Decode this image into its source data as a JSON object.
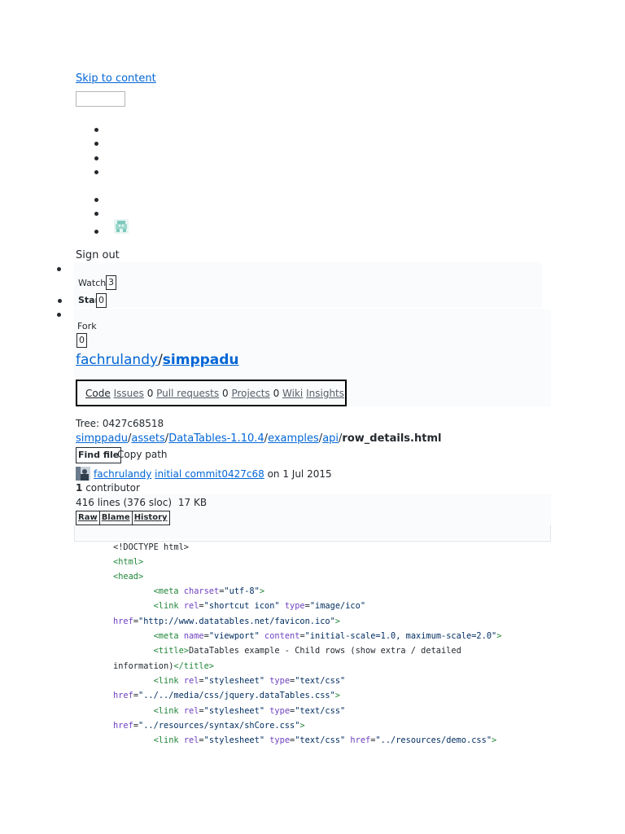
{
  "skip_link": "Skip to content",
  "search": {
    "value": "",
    "placeholder": ""
  },
  "signout": "Sign out",
  "watch": {
    "label": "Watch",
    "count": "3"
  },
  "star": {
    "label": "Star",
    "count": "0"
  },
  "fork": {
    "label": "Fork",
    "count": "0"
  },
  "repo": {
    "owner": "fachrulandy",
    "separator": "/",
    "name": "simppadu"
  },
  "tabs": {
    "code": "Code",
    "issues": "Issues",
    "issues_count": "0",
    "pulls": "Pull requests",
    "pulls_count": "0",
    "projects": "Projects",
    "projects_count": "0",
    "wiki": "Wiki",
    "insights": "Insights"
  },
  "tree": "Tree: 0427c68518",
  "breadcrumb": {
    "items": [
      "simppadu",
      "assets",
      "DataTables-1.10.4",
      "examples",
      "api"
    ],
    "sep": "/",
    "file": "row_details.html"
  },
  "find_file": "Find file",
  "copy_path": "Copy path",
  "commit": {
    "author": "fachrulandy",
    "message": "initial commit",
    "sha": "0427c68",
    "date_text": "on 1 Jul 2015"
  },
  "contributors": {
    "count": "1",
    "label": "contributor"
  },
  "file_info": {
    "lines": "416 lines (376 sloc)",
    "size": "17 KB"
  },
  "file_buttons": {
    "raw": "Raw",
    "blame": "Blame",
    "history": "History"
  },
  "code_lines": [
    [
      {
        "t": "<!DOCTYPE html>",
        "c": ""
      }
    ],
    [
      {
        "t": "<html>",
        "c": "tag"
      }
    ],
    [
      {
        "t": "<head>",
        "c": "tag"
      }
    ],
    [
      {
        "t": "        ",
        "c": ""
      },
      {
        "t": "<meta ",
        "c": "tag"
      },
      {
        "t": "charset",
        "c": "attr"
      },
      {
        "t": "=",
        "c": ""
      },
      {
        "t": "\"utf-8\"",
        "c": "str"
      },
      {
        "t": ">",
        "c": "tag"
      }
    ],
    [
      {
        "t": "        ",
        "c": ""
      },
      {
        "t": "<link ",
        "c": "tag"
      },
      {
        "t": "rel",
        "c": "attr"
      },
      {
        "t": "=",
        "c": ""
      },
      {
        "t": "\"shortcut icon\"",
        "c": "str"
      },
      {
        "t": " type",
        "c": "attr"
      },
      {
        "t": "=",
        "c": ""
      },
      {
        "t": "\"image/ico\"",
        "c": "str"
      }
    ],
    [
      {
        "t": "href",
        "c": "attr"
      },
      {
        "t": "=",
        "c": ""
      },
      {
        "t": "\"http://www.datatables.net/favicon.ico\"",
        "c": "str"
      },
      {
        "t": ">",
        "c": "tag"
      }
    ],
    [
      {
        "t": "        ",
        "c": ""
      },
      {
        "t": "<meta ",
        "c": "tag"
      },
      {
        "t": "name",
        "c": "attr"
      },
      {
        "t": "=",
        "c": ""
      },
      {
        "t": "\"viewport\"",
        "c": "str"
      },
      {
        "t": " content",
        "c": "attr"
      },
      {
        "t": "=",
        "c": ""
      },
      {
        "t": "\"initial-scale=1.0, maximum-scale=2.0\"",
        "c": "str"
      },
      {
        "t": ">",
        "c": "tag"
      }
    ],
    [
      {
        "t": "        ",
        "c": ""
      },
      {
        "t": "<title>",
        "c": "tag"
      },
      {
        "t": "DataTables example - Child rows (show extra / detailed",
        "c": ""
      }
    ],
    [
      {
        "t": "information)",
        "c": ""
      },
      {
        "t": "</title>",
        "c": "tag"
      }
    ],
    [
      {
        "t": "        ",
        "c": ""
      },
      {
        "t": "<link ",
        "c": "tag"
      },
      {
        "t": "rel",
        "c": "attr"
      },
      {
        "t": "=",
        "c": ""
      },
      {
        "t": "\"stylesheet\"",
        "c": "str"
      },
      {
        "t": " type",
        "c": "attr"
      },
      {
        "t": "=",
        "c": ""
      },
      {
        "t": "\"text/css\"",
        "c": "str"
      }
    ],
    [
      {
        "t": "href",
        "c": "attr"
      },
      {
        "t": "=",
        "c": ""
      },
      {
        "t": "\"../../media/css/jquery.dataTables.css\"",
        "c": "str"
      },
      {
        "t": ">",
        "c": "tag"
      }
    ],
    [
      {
        "t": "        ",
        "c": ""
      },
      {
        "t": "<link ",
        "c": "tag"
      },
      {
        "t": "rel",
        "c": "attr"
      },
      {
        "t": "=",
        "c": ""
      },
      {
        "t": "\"stylesheet\"",
        "c": "str"
      },
      {
        "t": " type",
        "c": "attr"
      },
      {
        "t": "=",
        "c": ""
      },
      {
        "t": "\"text/css\"",
        "c": "str"
      }
    ],
    [
      {
        "t": "href",
        "c": "attr"
      },
      {
        "t": "=",
        "c": ""
      },
      {
        "t": "\"../resources/syntax/shCore.css\"",
        "c": "str"
      },
      {
        "t": ">",
        "c": "tag"
      }
    ],
    [
      {
        "t": "        ",
        "c": ""
      },
      {
        "t": "<link ",
        "c": "tag"
      },
      {
        "t": "rel",
        "c": "attr"
      },
      {
        "t": "=",
        "c": ""
      },
      {
        "t": "\"stylesheet\"",
        "c": "str"
      },
      {
        "t": " type",
        "c": "attr"
      },
      {
        "t": "=",
        "c": ""
      },
      {
        "t": "\"text/css\"",
        "c": "str"
      },
      {
        "t": " href",
        "c": "attr"
      },
      {
        "t": "=",
        "c": ""
      },
      {
        "t": "\"../resources/demo.css\"",
        "c": "str"
      },
      {
        "t": ">",
        "c": "tag"
      }
    ]
  ]
}
